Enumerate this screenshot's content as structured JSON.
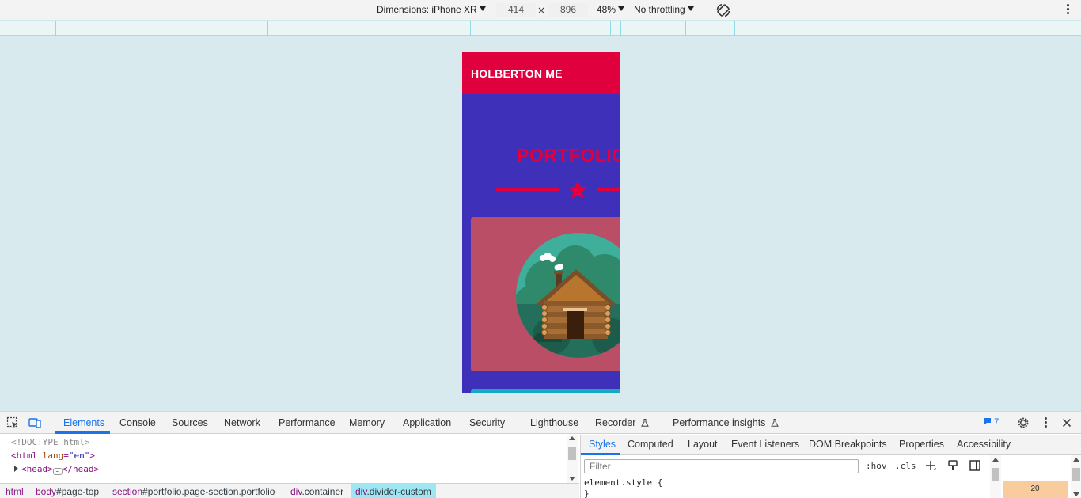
{
  "device_toolbar": {
    "dimensions_label": "Dimensions: iPhone XR",
    "width": "414",
    "times": "×",
    "height": "896",
    "zoom": "48%",
    "throttling": "No throttling",
    "rotate_icon": "rotate-icon",
    "more_icon": "kebab-menu-icon"
  },
  "viewport": {
    "brand": "HOLBERTON ME",
    "section_title": "PORTFOLIO",
    "colors": {
      "nav_bg": "#e1003e",
      "section_bg": "#3e30b8",
      "card_bg": "#b94e66",
      "card2_bg": "#16a9c3"
    }
  },
  "devtools": {
    "tabs": [
      {
        "label": "Elements"
      },
      {
        "label": "Console"
      },
      {
        "label": "Sources"
      },
      {
        "label": "Network"
      },
      {
        "label": "Performance"
      },
      {
        "label": "Memory"
      },
      {
        "label": "Application"
      },
      {
        "label": "Security"
      },
      {
        "label": "Lighthouse"
      },
      {
        "label": "Recorder"
      },
      {
        "label": "Performance insights"
      }
    ],
    "issues_count": "7",
    "elements": {
      "doctype": "<!DOCTYPE html>",
      "html_open_tag": "<html",
      "html_attr": "lang",
      "html_attr_val": "\"en\"",
      "head_open": "<head>",
      "head_close": "</head>",
      "ellipsis": "…"
    },
    "breadcrumbs": [
      {
        "tag": "html",
        "rest": ""
      },
      {
        "tag": "body",
        "rest": "#page-top"
      },
      {
        "tag": "section",
        "rest": "#portfolio.page-section.portfolio"
      },
      {
        "tag": "div",
        "rest": ".container"
      },
      {
        "tag": "div",
        "rest": ".divider-custom"
      }
    ],
    "styles": {
      "tabs": [
        "Styles",
        "Computed",
        "Layout",
        "Event Listeners",
        "DOM Breakpoints",
        "Properties",
        "Accessibility"
      ],
      "filter_placeholder": "Filter",
      "hov": ":hov",
      "cls": ".cls",
      "rule_selector": "element.style {",
      "rule_close": "}",
      "margin_value": "20"
    }
  }
}
